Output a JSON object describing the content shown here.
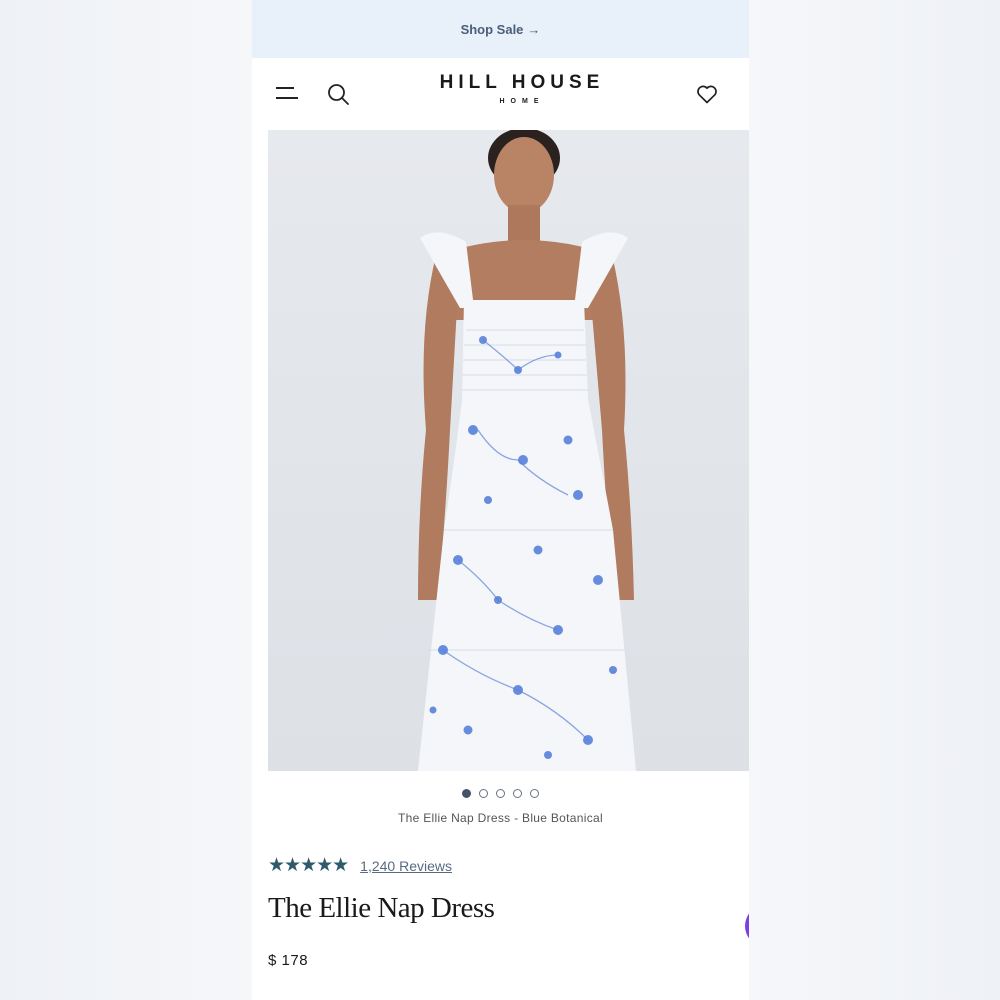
{
  "promo": {
    "label": "Shop Sale",
    "arrow": "→"
  },
  "header": {
    "brand": "HILL HOUSE",
    "sub": "HOME"
  },
  "product": {
    "dots_total": 5,
    "active_dot": 1,
    "caption": "The Ellie Nap Dress - Blue Botanical",
    "stars": "★★★★★",
    "reviews_label": "1,240 Reviews",
    "title": "The Ellie Nap Dress",
    "price": "$ 178"
  },
  "colors": {
    "accent": "#2f5a6e",
    "promo_bg": "#e8f0fa",
    "chat": "#7b3fe4",
    "print": "#4f7ad8"
  },
  "icons": [
    "menu-icon",
    "search-icon",
    "heart-icon",
    "chat-icon"
  ]
}
